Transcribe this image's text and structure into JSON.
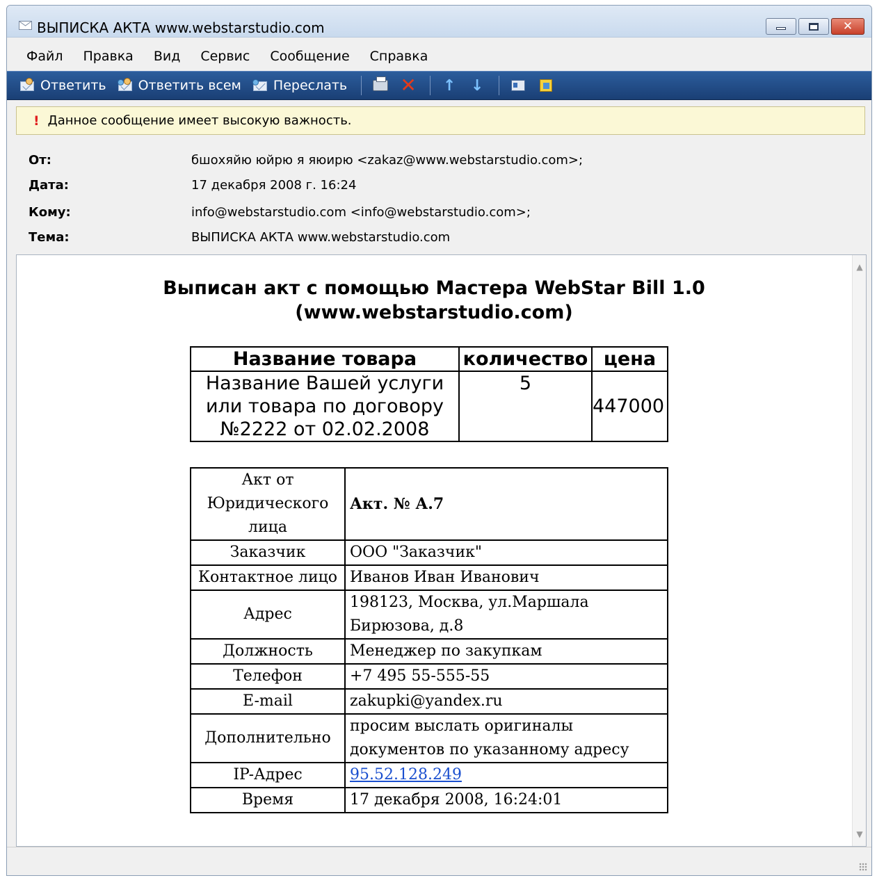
{
  "window": {
    "title": "ВЫПИСКА АКТА www.webstarstudio.com"
  },
  "menu": [
    "Файл",
    "Правка",
    "Вид",
    "Сервис",
    "Сообщение",
    "Справка"
  ],
  "toolbar": {
    "reply": "Ответить",
    "reply_all": "Ответить всем",
    "forward": "Переслать"
  },
  "info_bar": {
    "text": "Данное сообщение имеет высокую важность."
  },
  "headers": {
    "from_label": "От:",
    "from_value": "бшохяйю юйрю я яюирю <zakaz@www.webstarstudio.com>;",
    "date_label": "Дата:",
    "date_value": "17 декабря 2008 г. 16:24",
    "to_label": "Кому:",
    "to_value": "info@webstarstudio.com <info@webstarstudio.com>;",
    "subject_label": "Тема:",
    "subject_value": "ВЫПИСКА АКТА www.webstarstudio.com"
  },
  "body": {
    "title_line1": "Выписан акт с помощью Мастера WebStar Bill 1.0",
    "title_line2": "(www.webstarstudio.com)",
    "items_table": {
      "headers": [
        "Название товара",
        "количество",
        "цена"
      ],
      "row": {
        "name": "Название Вашей услуги или товара по договору №2222 от 02.02.2008",
        "qty": "5",
        "price": "447000"
      }
    },
    "act_table": [
      {
        "k": "Акт от Юридического лица",
        "v": "Акт. № А.7"
      },
      {
        "k": "Заказчик",
        "v": "ООО \"Заказчик\""
      },
      {
        "k": "Контактное лицо",
        "v": "Иванов Иван Иванович"
      },
      {
        "k": "Адрес",
        "v": "198123, Москва, ул.Маршала Бирюзова, д.8"
      },
      {
        "k": "Должность",
        "v": "Менеджер по закупкам"
      },
      {
        "k": "Телефон",
        "v": "+7 495 55-555-55"
      },
      {
        "k": "E-mail",
        "v": "zakupki@yandex.ru"
      },
      {
        "k": "Дополнительно",
        "v": "просим выслать оригиналы документов по указанному адресу"
      },
      {
        "k": "IP-Адрес",
        "v": "95.52.128.249"
      },
      {
        "k": "Время",
        "v": "17 декабря 2008, 16:24:01"
      }
    ]
  },
  "icons": {
    "title": "envelope-icon",
    "print": "printer-icon",
    "delete": "delete-icon",
    "prev": "arrow-up-icon",
    "next": "arrow-down-icon",
    "contacts": "contact-card-icon",
    "addresses": "address-book-icon"
  },
  "colors": {
    "toolbar_bg": "#1a3f75",
    "info_bg": "#fbf8d6",
    "link": "#1a4fcf",
    "important": "#e02020"
  }
}
